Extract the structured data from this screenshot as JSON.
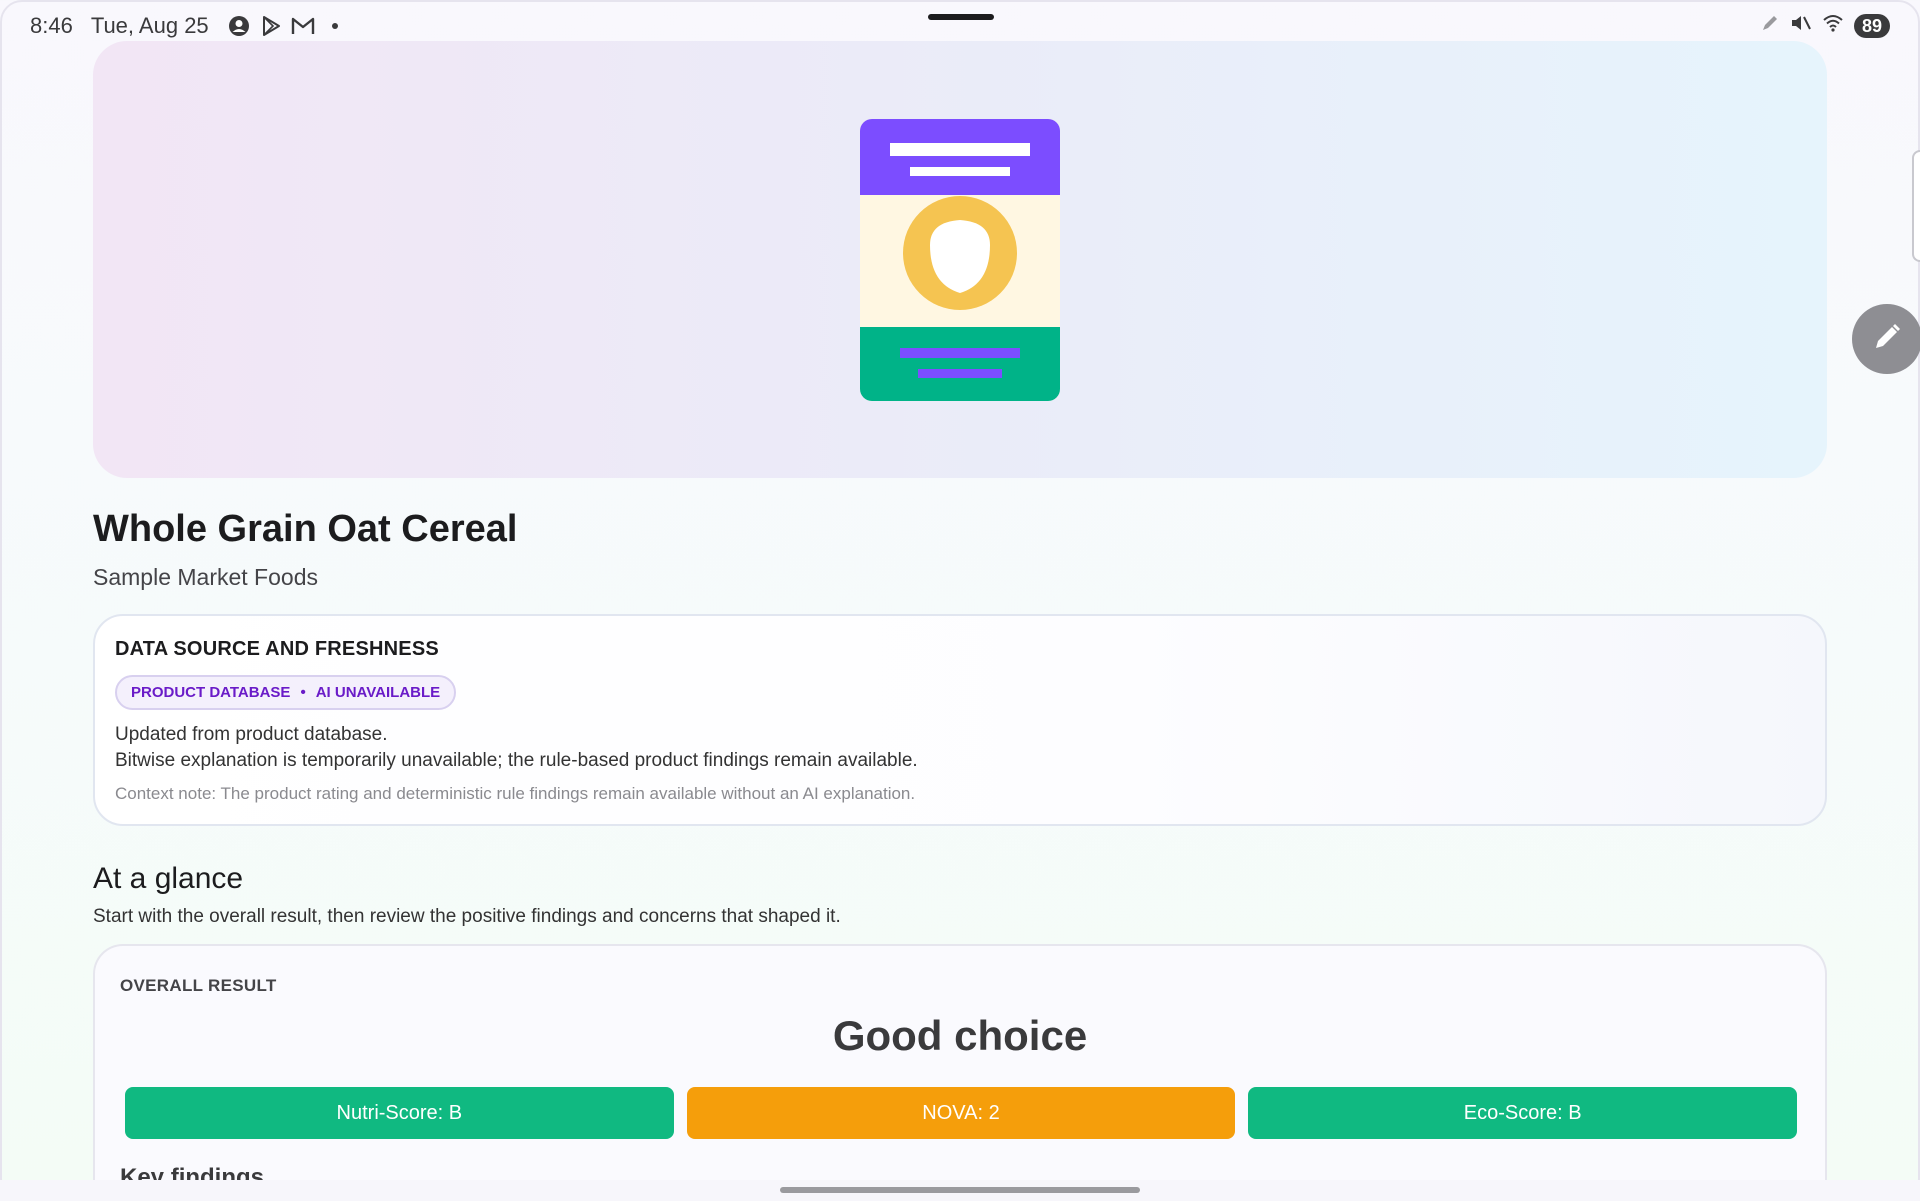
{
  "status_bar": {
    "time": "8:46",
    "date": "Tue, Aug 25",
    "icons": [
      "account-circle-icon",
      "play-store-icon",
      "gmail-icon",
      "dot-icon"
    ],
    "right_icons": [
      "pen-icon",
      "mute-icon",
      "wifi-icon"
    ],
    "battery": "89"
  },
  "product": {
    "name": "Whole Grain Oat Cereal",
    "brand": "Sample Market Foods",
    "art_colors": {
      "top": "#7c4dff",
      "middle": "#fff7e2",
      "emblem": "#f5c451",
      "bottom": "#00b388"
    }
  },
  "data_source": {
    "heading": "DATA SOURCE AND FRESHNESS",
    "chip_source": "PRODUCT DATABASE",
    "chip_separator": "•",
    "chip_ai": "AI UNAVAILABLE",
    "line1": "Updated from product database.",
    "line2": "Bitwise explanation is temporarily unavailable; the rule-based product findings remain available.",
    "note": "Context note: The product rating and deterministic rule findings remain available without an AI explanation."
  },
  "glance": {
    "title": "At a glance",
    "subtitle": "Start with the overall result, then review the positive findings and concerns that shaped it.",
    "overall_label": "OVERALL RESULT",
    "overall_value": "Good choice",
    "scores": [
      {
        "label": "Nutri-Score: B",
        "color": "#10b981"
      },
      {
        "label": "NOVA: 2",
        "color": "#f59e0b"
      },
      {
        "label": "Eco-Score: B",
        "color": "#10b981"
      }
    ],
    "key_findings": "Key findings"
  }
}
